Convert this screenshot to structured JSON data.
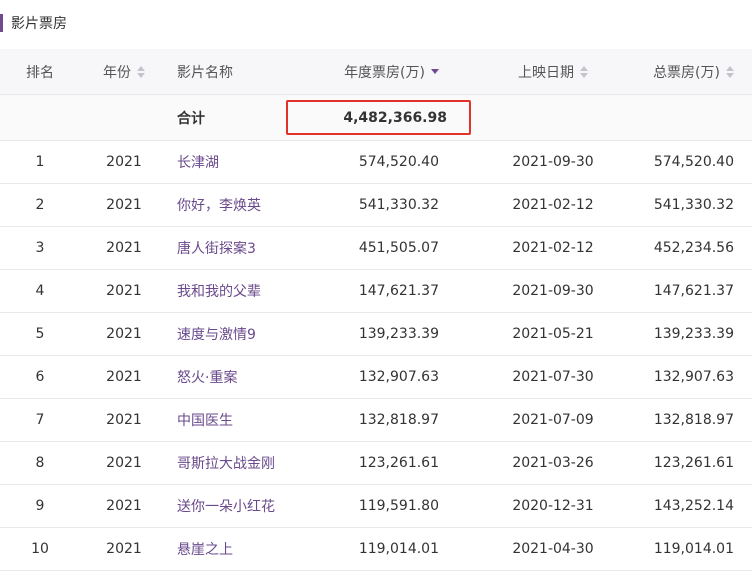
{
  "section": {
    "title": "影片票房"
  },
  "colors": {
    "accent": "#6e4a8e",
    "link": "#6a4a8c",
    "highlight_border": "#e0312b"
  },
  "table": {
    "headers": {
      "rank": "排名",
      "year": "年份",
      "name": "影片名称",
      "annual": "年度票房(万)",
      "date": "上映日期",
      "total": "总票房(万)"
    },
    "sort_state": {
      "annual": "descending"
    },
    "total_row": {
      "label": "合计",
      "annual": "4,482,366.98"
    },
    "rows": [
      {
        "rank": "1",
        "year": "2021",
        "name": "长津湖",
        "annual": "574,520.40",
        "date": "2021-09-30",
        "total": "574,520.40"
      },
      {
        "rank": "2",
        "year": "2021",
        "name": "你好，李焕英",
        "annual": "541,330.32",
        "date": "2021-02-12",
        "total": "541,330.32"
      },
      {
        "rank": "3",
        "year": "2021",
        "name": "唐人街探案3",
        "annual": "451,505.07",
        "date": "2021-02-12",
        "total": "452,234.56"
      },
      {
        "rank": "4",
        "year": "2021",
        "name": "我和我的父辈",
        "annual": "147,621.37",
        "date": "2021-09-30",
        "total": "147,621.37"
      },
      {
        "rank": "5",
        "year": "2021",
        "name": "速度与激情9",
        "annual": "139,233.39",
        "date": "2021-05-21",
        "total": "139,233.39"
      },
      {
        "rank": "6",
        "year": "2021",
        "name": "怒火·重案",
        "annual": "132,907.63",
        "date": "2021-07-30",
        "total": "132,907.63"
      },
      {
        "rank": "7",
        "year": "2021",
        "name": "中国医生",
        "annual": "132,818.97",
        "date": "2021-07-09",
        "total": "132,818.97"
      },
      {
        "rank": "8",
        "year": "2021",
        "name": "哥斯拉大战金刚",
        "annual": "123,261.61",
        "date": "2021-03-26",
        "total": "123,261.61"
      },
      {
        "rank": "9",
        "year": "2021",
        "name": "送你一朵小红花",
        "annual": "119,591.80",
        "date": "2020-12-31",
        "total": "143,252.14"
      },
      {
        "rank": "10",
        "year": "2021",
        "name": "悬崖之上",
        "annual": "119,014.01",
        "date": "2021-04-30",
        "total": "119,014.01"
      }
    ]
  }
}
